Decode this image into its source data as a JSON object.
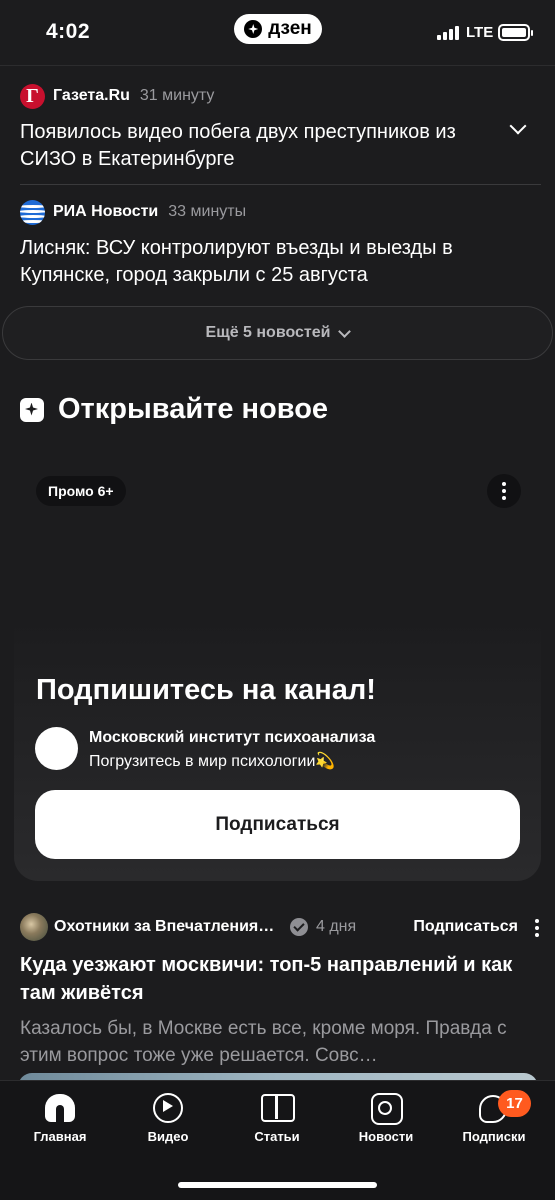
{
  "status_bar": {
    "time": "4:02",
    "app_badge": "дзен",
    "network": "LTE",
    "battery_level": 1.0
  },
  "news": [
    {
      "source": "Газета.Ru",
      "logo_letter": "Г",
      "time": "31 минуту",
      "title": "Появилось видео побега двух преступников из СИЗО в Екатеринбурге"
    },
    {
      "source": "РИА Новости",
      "time": "33 минуты",
      "title": "Лисняк: ВСУ контролируют въезды и выезды в Купянске, город закрыли с 25 августа"
    }
  ],
  "more_news_label": "Ещё 5 новостей",
  "section": {
    "title": "Открывайте новое"
  },
  "promo": {
    "badge": "Промо 6+",
    "title": "Подпишитесь на канал!",
    "channel_name": "Московский институт психоанализа",
    "channel_desc": "Погрузитесь в мир психологии💫",
    "cta_label": "Подписаться"
  },
  "post": {
    "channel": "Охотники за Впечатления…",
    "time": "4 дня",
    "subscribe_label": "Подписаться",
    "title": "Куда уезжают москвичи: топ-5 направлений и как там живётся",
    "snippet": "Казалось бы, в Москве есть все, кроме моря. Правда с этим вопрос тоже уже решается. Совс…"
  },
  "tabbar": {
    "tabs": [
      {
        "label": "Главная",
        "icon": "home-icon",
        "active": true
      },
      {
        "label": "Видео",
        "icon": "video-icon"
      },
      {
        "label": "Статьи",
        "icon": "articles-icon"
      },
      {
        "label": "Новости",
        "icon": "news-icon"
      },
      {
        "label": "Подписки",
        "icon": "subscriptions-icon"
      }
    ],
    "subscriptions_badge": "17"
  },
  "colors": {
    "background": "#1c1c1e",
    "badge": "#ff5a1f",
    "gazeta_red": "#c8102e",
    "ria_blue": "#1f6bd6"
  }
}
